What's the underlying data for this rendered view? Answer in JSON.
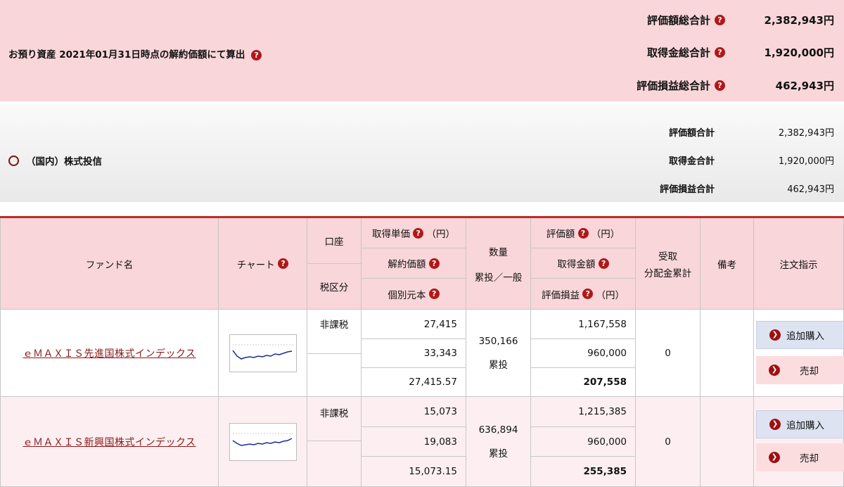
{
  "summary": {
    "asof_text": "お預り資産 2021年01月31日時点の解約価額にて算出",
    "rows": [
      {
        "label": "評価額総合計",
        "value": "2,382,943円"
      },
      {
        "label": "取得金総合計",
        "value": "1,920,000円"
      },
      {
        "label": "評価損益総合計",
        "value": "462,943円"
      }
    ]
  },
  "category": {
    "title": "（国内）株式投信",
    "rows": [
      {
        "label": "評価額合計",
        "value": "2,382,943円"
      },
      {
        "label": "取得金合計",
        "value": "1,920,000円"
      },
      {
        "label": "評価損益合計",
        "value": "462,943円"
      }
    ]
  },
  "table": {
    "headers": {
      "fund_name": "ファンド名",
      "chart": "チャート",
      "account": "口座",
      "tax": "税区分",
      "unit_price": "取得単価",
      "unit_price_suffix": "（円）",
      "nav": "解約価額",
      "principal": "個別元本",
      "quantity": "数量",
      "quantity_sub": "累投／一般",
      "valuation": "評価額",
      "valuation_suffix": "（円）",
      "cost": "取得金額",
      "pl": "評価損益",
      "pl_suffix": "（円）",
      "dividend_1": "受取",
      "dividend_2": "分配金累計",
      "remarks": "備考",
      "order": "注文指示"
    },
    "rows": [
      {
        "fund": "ｅＭＡＸＩＳ先進国株式インデックス",
        "tax": "非課税",
        "unit_price": "27,415",
        "nav": "33,343",
        "principal": "27,415.57",
        "quantity": "350,166",
        "quantity_type": "累投",
        "valuation": "1,167,558",
        "cost": "960,000",
        "pl": "207,558",
        "dividend": "0",
        "add_label": "追加購入",
        "sell_label": "売却"
      },
      {
        "fund": "ｅＭＡＸＩＳ新興国株式インデックス",
        "tax": "非課税",
        "unit_price": "15,073",
        "nav": "19,083",
        "principal": "15,073.15",
        "quantity": "636,894",
        "quantity_type": "累投",
        "valuation": "1,215,385",
        "cost": "960,000",
        "pl": "255,385",
        "dividend": "0",
        "add_label": "追加購入",
        "sell_label": "売却"
      }
    ]
  },
  "icons": {
    "help": "question-circle-icon",
    "arrow": "arrow-right-circle-icon"
  },
  "colors": {
    "header_bg": "#f8d6d9",
    "accent": "#b01818",
    "link": "#8a1a1a"
  }
}
